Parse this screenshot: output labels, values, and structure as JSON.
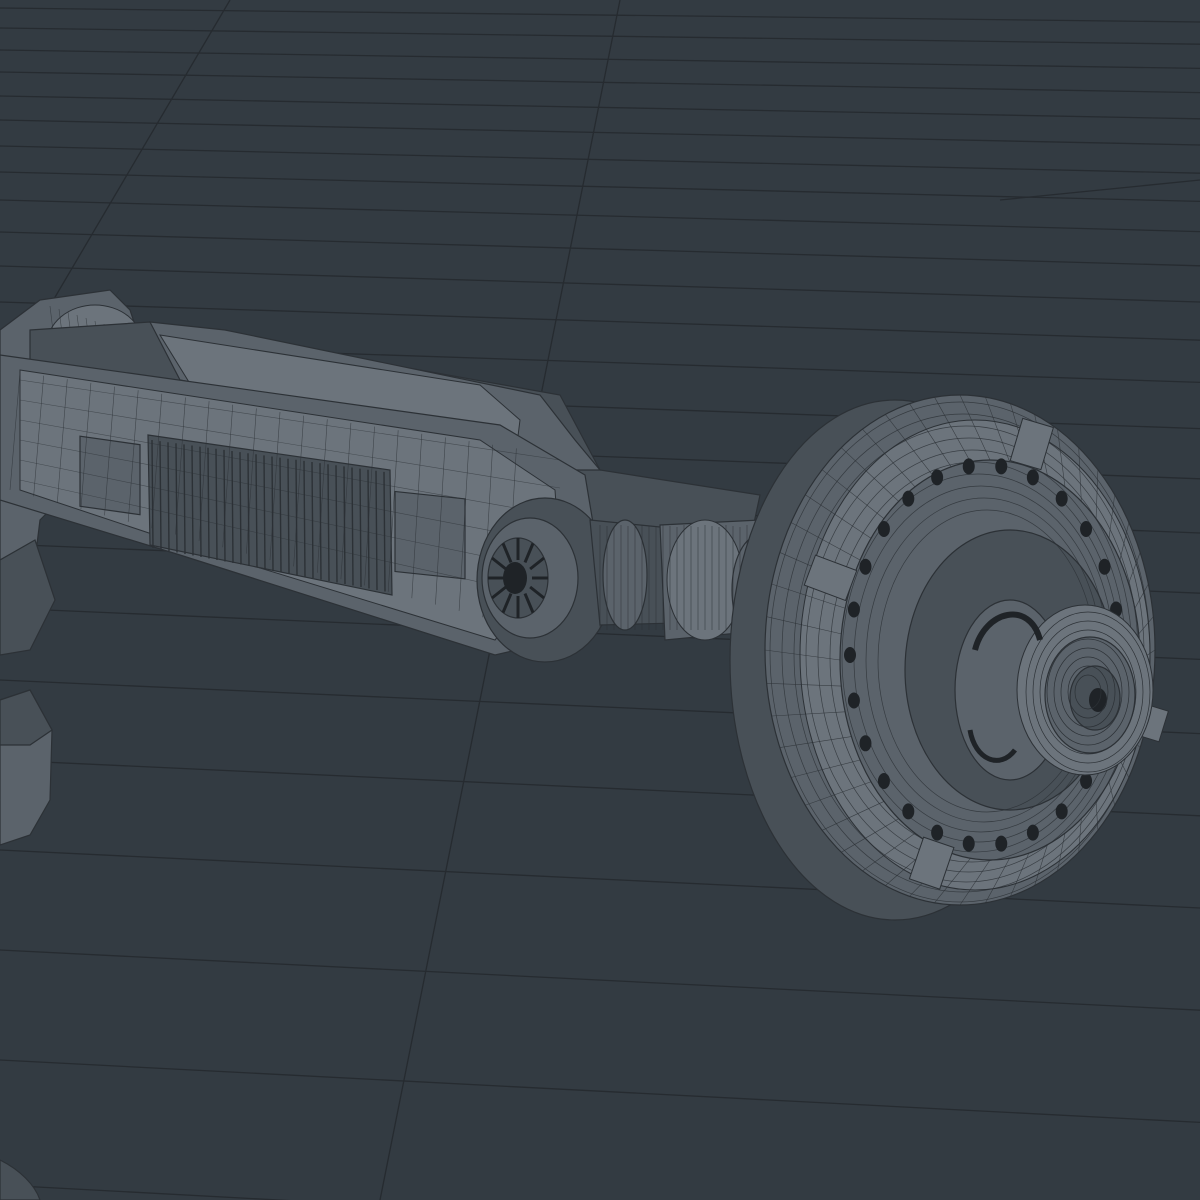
{
  "viewport": {
    "label": "",
    "background_color": "#333b42",
    "grid_color": "#262b30",
    "mesh_fill": "#5b636b",
    "mesh_fill_dark": "#485057",
    "mesh_fill_light": "#6c747c",
    "wire_color": "#2c3136",
    "hole_color": "#1f2327"
  },
  "model": {
    "parts": [
      "upper-arm-housing",
      "vent-grille",
      "elbow-pulley",
      "axle-shaft",
      "wheel-disc",
      "wheel-hub",
      "left-joint-housing",
      "lower-left-wheel"
    ]
  }
}
